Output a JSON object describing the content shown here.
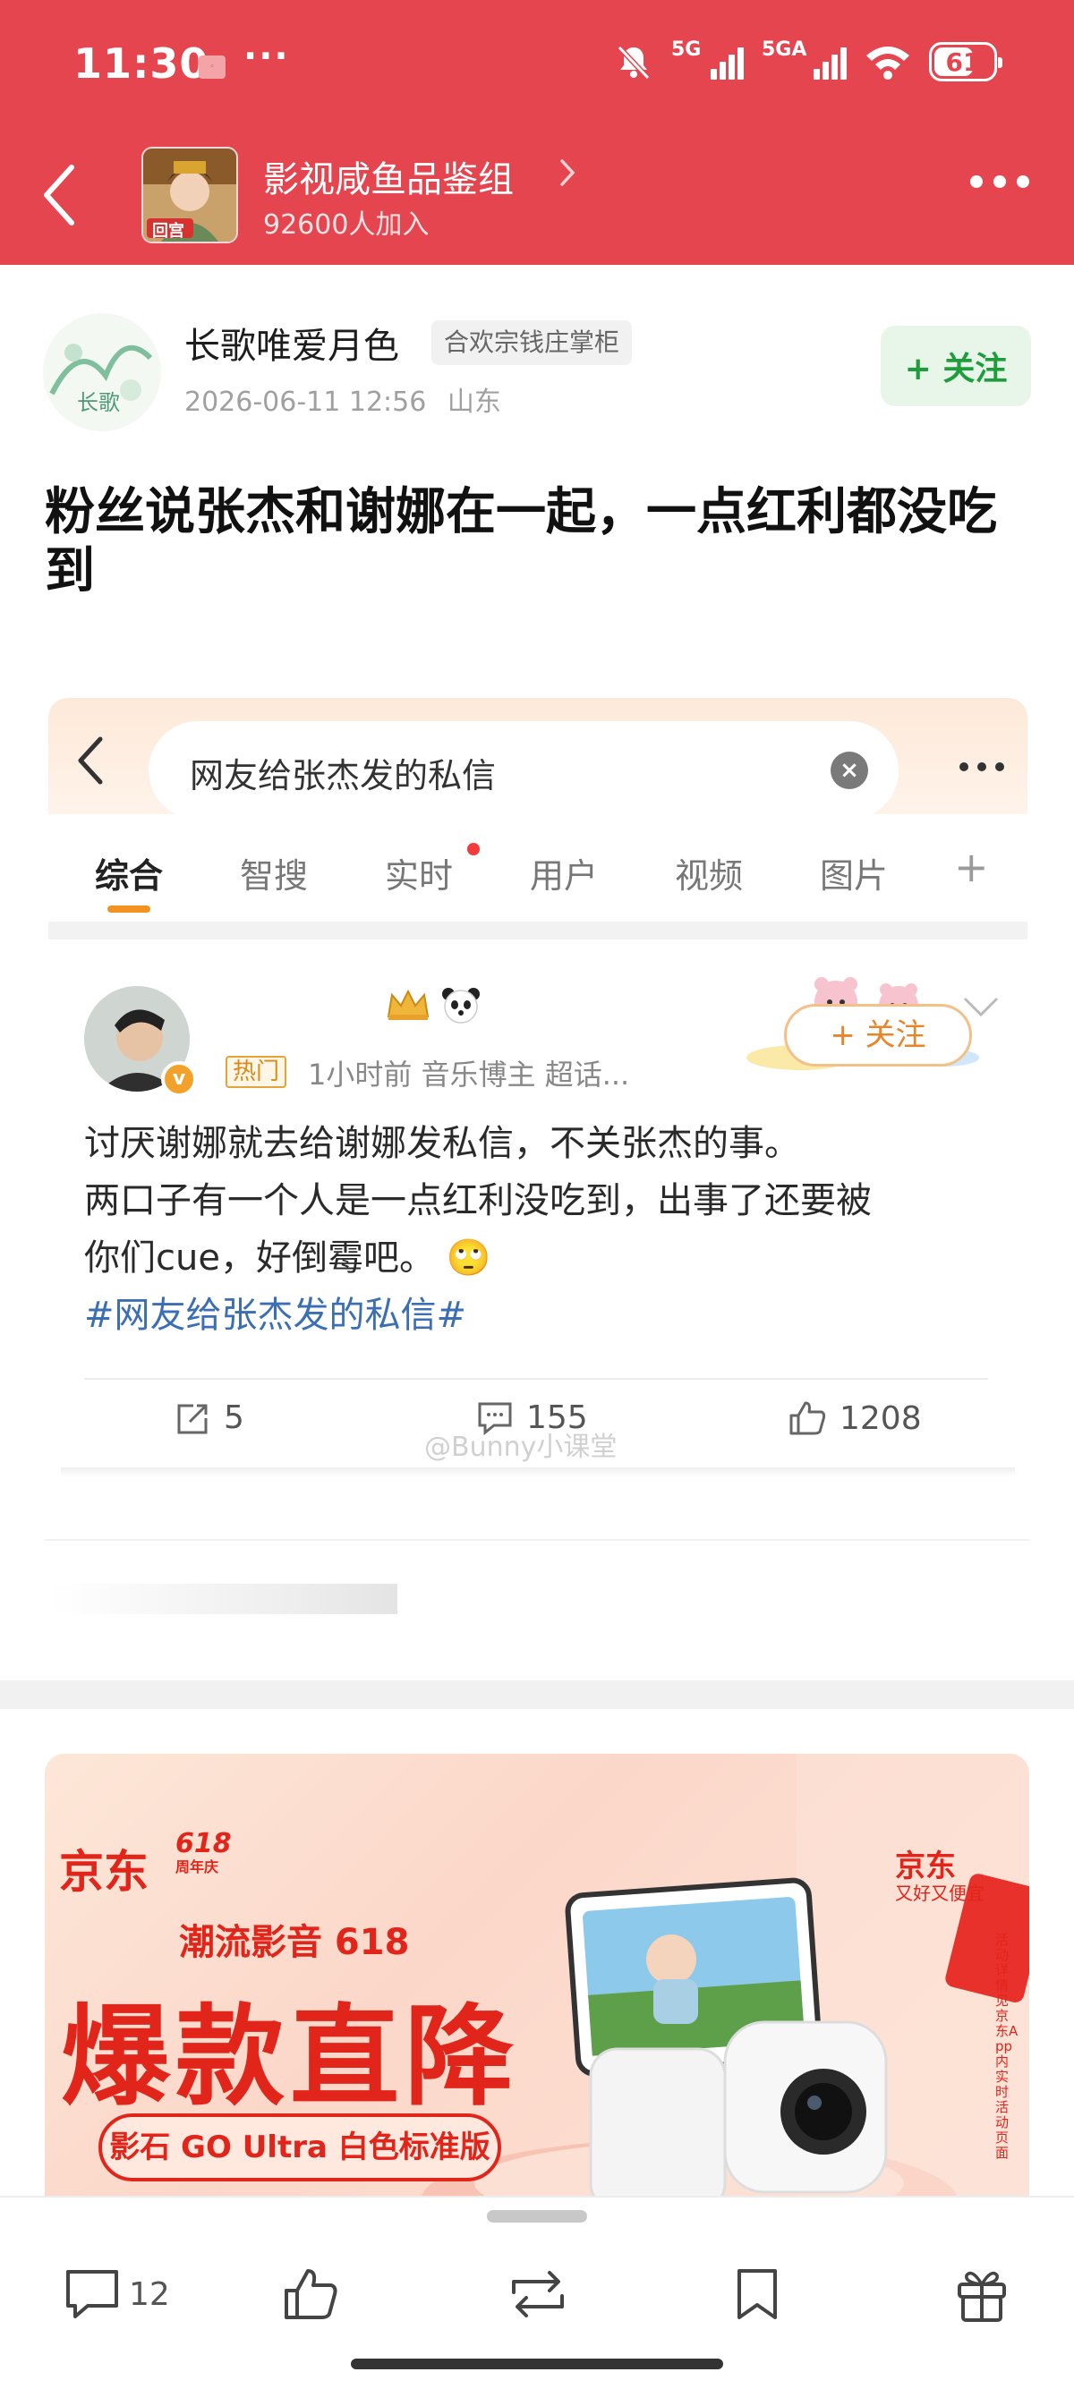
{
  "status_bar": {
    "time": "11:30",
    "more": "···",
    "signal_1_label": "5G",
    "signal_2_label": "5GA",
    "battery": "61"
  },
  "header": {
    "group_name": "影视咸鱼品鉴组",
    "member_count": "92600人加入",
    "avatar_label": "回宫"
  },
  "post": {
    "author_name": "长歌唯爱月色",
    "author_badge": "合欢宗钱庄掌柜",
    "avatar_label": "长歌",
    "timestamp": "2026-06-11 12:56",
    "location": "山东",
    "follow_label": "+ 关注",
    "title": "粉丝说张杰和谢娜在一起，一点红利都没吃到"
  },
  "screenshot": {
    "search_text": "网友给张杰发的私信",
    "tabs": [
      {
        "label": "综合"
      },
      {
        "label": "智搜"
      },
      {
        "label": "实时"
      },
      {
        "label": "用户"
      },
      {
        "label": "视频"
      },
      {
        "label": "图片"
      }
    ],
    "hot_badge": "热门",
    "meta": "1小时前   音乐博主 超话...",
    "follow_label": "+ 关注",
    "text_lines": [
      "讨厌谢娜就去给谢娜发私信，不关张杰的事。",
      "两口子有一个人是一点红利没吃到，出事了还要被",
      "你们cue，好倒霉吧。 🙄"
    ],
    "hashtag": "#网友给张杰发的私信#",
    "shares": "5",
    "comments": "155",
    "likes": "1208",
    "watermark": "@Bunny小课堂"
  },
  "ad": {
    "brand": "京东",
    "brand_num": "618",
    "brand_sub": "周年庆",
    "subtitle": "潮流影音 618",
    "headline": "爆款直降",
    "product": "影石 GO Ultra 白色标准版",
    "logo": "京东",
    "logo_sub": "又好又便宜",
    "side_text": "活动详情见京东App内实时活动页面"
  },
  "bottom_bar": {
    "comment_count": "12"
  },
  "colors": {
    "header_red": "#e5454f",
    "follow_green": "#1f9d3c",
    "hashtag_blue": "#3b6eb3",
    "jd_red": "#e1251b"
  }
}
